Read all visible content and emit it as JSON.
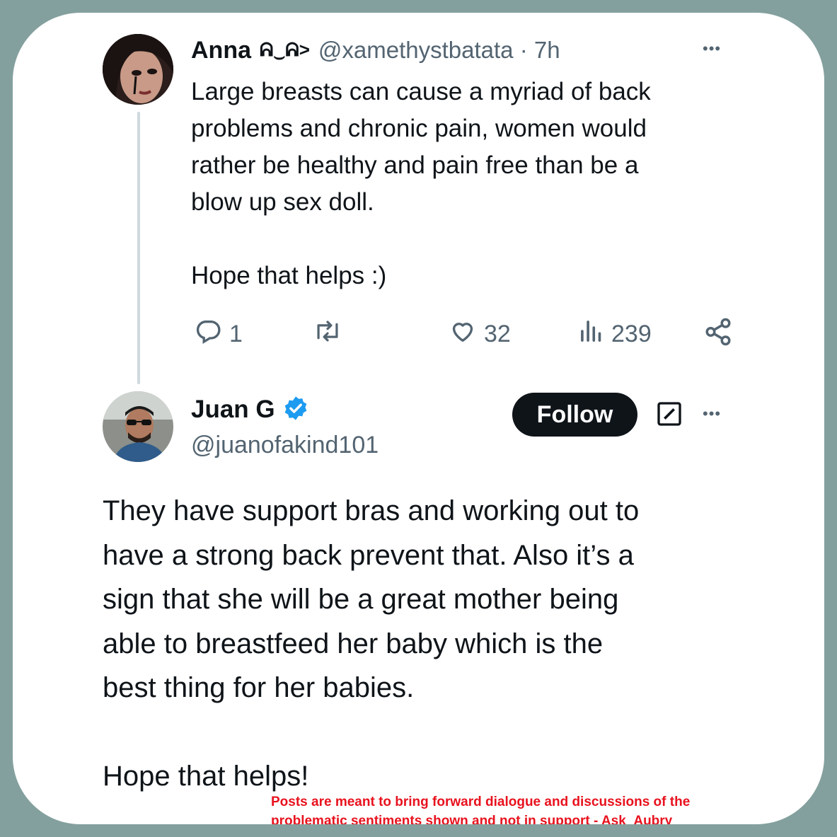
{
  "anna": {
    "display_name": "Anna",
    "name_emoticon": "ᕱ‿ᕱ>",
    "handle_time": "@xamethystbatata · 7h",
    "more": "•••",
    "text": "Large breasts can cause a myriad of back\nproblems and chronic pain, women would\nrather be healthy and pain free than be a\nblow up sex doll.\n\nHope that helps :)",
    "actions": {
      "replies": "1",
      "likes": "32",
      "views": "239"
    }
  },
  "juan": {
    "display_name": "Juan G",
    "handle": "@juanofakind101",
    "follow_label": "Follow",
    "more": "•••",
    "text": "They have support bras and working out to\nhave a strong back prevent that. Also it’s a\nsign that she will be a great mother being\nable to breastfeed her baby which is the\nbest thing for her babies.\n\nHope that helps!"
  },
  "disclaimer": {
    "line1": "Posts are meant to bring forward dialogue and discussions of the",
    "line2": "problematic sentiments shown and not in support - Ask_Aubry"
  },
  "colors": {
    "background": "#83a09e",
    "verified": "#1d9bf0",
    "disclaimer": "#e8121e",
    "follow_button": "#0f1419"
  },
  "icons": [
    "reply-icon",
    "retweet-icon",
    "like-icon",
    "views-icon",
    "share-icon",
    "verified-badge-icon",
    "grok-icon",
    "more-icon"
  ]
}
